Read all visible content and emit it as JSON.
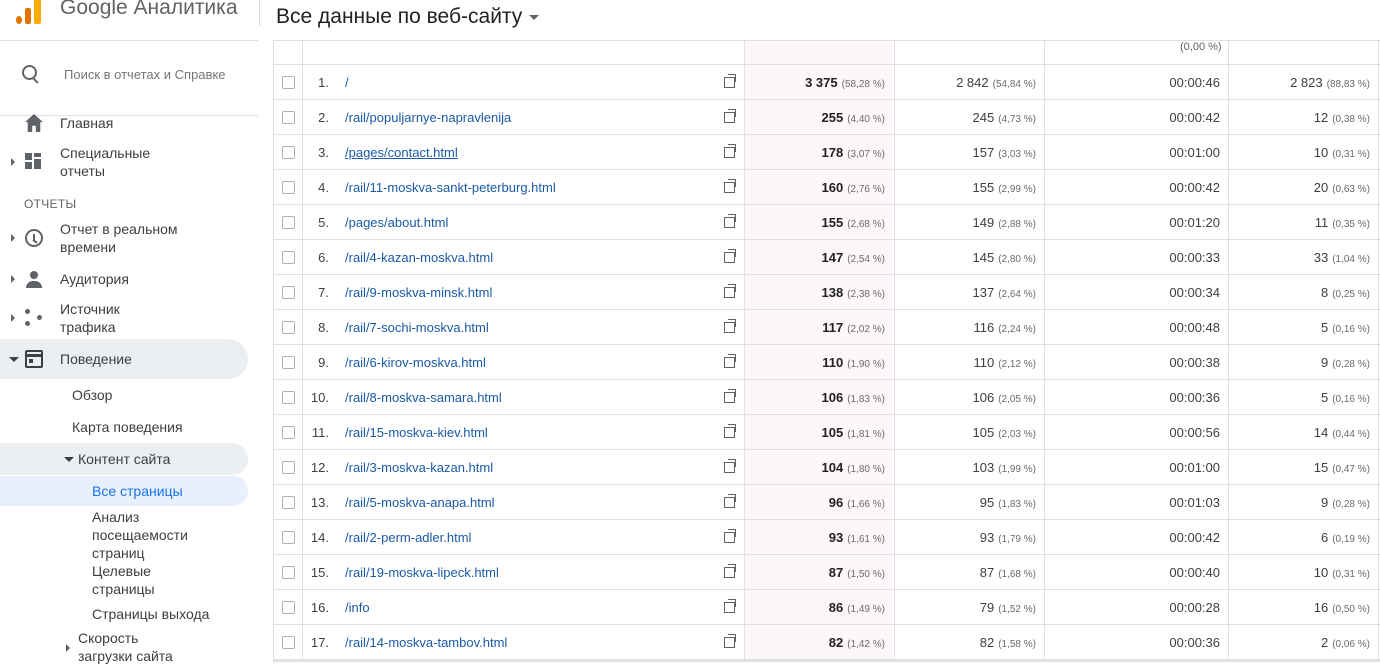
{
  "app": {
    "brand": "Google Аналитика",
    "view_title": "Все данные по веб-сайту"
  },
  "sidebar": {
    "search_placeholder": "Поиск в отчетах и Справке",
    "home": "Главная",
    "custom_line1": "Специальные",
    "custom_line2": "отчеты",
    "reports_section": "ОТЧЕТЫ",
    "realtime_line1": "Отчет в реальном",
    "realtime_line2": "времени",
    "audience": "Аудитория",
    "source_line1": "Источник",
    "source_line2": "трафика",
    "behavior": "Поведение",
    "overview": "Обзор",
    "behavior_map": "Карта поведения",
    "site_content": "Контент сайта",
    "all_pages": "Все страницы",
    "analysis_line1": "Анализ",
    "analysis_line2": "посещаемости",
    "analysis_line3": "страниц",
    "landing_line1": "Целевые",
    "landing_line2": "страницы",
    "exit_pages": "Страницы выхода",
    "speed_line1": "Скорость",
    "speed_line2": "загрузки сайта"
  },
  "table": {
    "header_pct": "(0,00 %)",
    "rows": [
      {
        "idx": "1.",
        "page": "/",
        "v1": "3 375",
        "p1": "(58,28 %)",
        "v2": "2 842",
        "p2": "(54,84 %)",
        "time": "00:00:46",
        "v4": "2 823",
        "p4": "(88,83 %)"
      },
      {
        "idx": "2.",
        "page": "/rail/populjarnye-napravlenija",
        "v1": "255",
        "p1": "(4,40 %)",
        "v2": "245",
        "p2": "(4,73 %)",
        "time": "00:00:42",
        "v4": "12",
        "p4": "(0,38 %)"
      },
      {
        "idx": "3.",
        "page": "/pages/contact.html",
        "v1": "178",
        "p1": "(3,07 %)",
        "v2": "157",
        "p2": "(3,03 %)",
        "time": "00:01:00",
        "v4": "10",
        "p4": "(0,31 %)"
      },
      {
        "idx": "4.",
        "page": "/rail/11-moskva-sankt-peterburg.html",
        "v1": "160",
        "p1": "(2,76 %)",
        "v2": "155",
        "p2": "(2,99 %)",
        "time": "00:00:42",
        "v4": "20",
        "p4": "(0,63 %)"
      },
      {
        "idx": "5.",
        "page": "/pages/about.html",
        "v1": "155",
        "p1": "(2,68 %)",
        "v2": "149",
        "p2": "(2,88 %)",
        "time": "00:01:20",
        "v4": "11",
        "p4": "(0,35 %)"
      },
      {
        "idx": "6.",
        "page": "/rail/4-kazan-moskva.html",
        "v1": "147",
        "p1": "(2,54 %)",
        "v2": "145",
        "p2": "(2,80 %)",
        "time": "00:00:33",
        "v4": "33",
        "p4": "(1,04 %)"
      },
      {
        "idx": "7.",
        "page": "/rail/9-moskva-minsk.html",
        "v1": "138",
        "p1": "(2,38 %)",
        "v2": "137",
        "p2": "(2,64 %)",
        "time": "00:00:34",
        "v4": "8",
        "p4": "(0,25 %)"
      },
      {
        "idx": "8.",
        "page": "/rail/7-sochi-moskva.html",
        "v1": "117",
        "p1": "(2,02 %)",
        "v2": "116",
        "p2": "(2,24 %)",
        "time": "00:00:48",
        "v4": "5",
        "p4": "(0,16 %)"
      },
      {
        "idx": "9.",
        "page": "/rail/6-kirov-moskva.html",
        "v1": "110",
        "p1": "(1,90 %)",
        "v2": "110",
        "p2": "(2,12 %)",
        "time": "00:00:38",
        "v4": "9",
        "p4": "(0,28 %)"
      },
      {
        "idx": "10.",
        "page": "/rail/8-moskva-samara.html",
        "v1": "106",
        "p1": "(1,83 %)",
        "v2": "106",
        "p2": "(2,05 %)",
        "time": "00:00:36",
        "v4": "5",
        "p4": "(0,16 %)"
      },
      {
        "idx": "11.",
        "page": "/rail/15-moskva-kiev.html",
        "v1": "105",
        "p1": "(1,81 %)",
        "v2": "105",
        "p2": "(2,03 %)",
        "time": "00:00:56",
        "v4": "14",
        "p4": "(0,44 %)"
      },
      {
        "idx": "12.",
        "page": "/rail/3-moskva-kazan.html",
        "v1": "104",
        "p1": "(1,80 %)",
        "v2": "103",
        "p2": "(1,99 %)",
        "time": "00:01:00",
        "v4": "15",
        "p4": "(0,47 %)"
      },
      {
        "idx": "13.",
        "page": "/rail/5-moskva-anapa.html",
        "v1": "96",
        "p1": "(1,66 %)",
        "v2": "95",
        "p2": "(1,83 %)",
        "time": "00:01:03",
        "v4": "9",
        "p4": "(0,28 %)"
      },
      {
        "idx": "14.",
        "page": "/rail/2-perm-adler.html",
        "v1": "93",
        "p1": "(1,61 %)",
        "v2": "93",
        "p2": "(1,79 %)",
        "time": "00:00:42",
        "v4": "6",
        "p4": "(0,19 %)"
      },
      {
        "idx": "15.",
        "page": "/rail/19-moskva-lipeck.html",
        "v1": "87",
        "p1": "(1,50 %)",
        "v2": "87",
        "p2": "(1,68 %)",
        "time": "00:00:40",
        "v4": "10",
        "p4": "(0,31 %)"
      },
      {
        "idx": "16.",
        "page": "/info",
        "v1": "86",
        "p1": "(1,49 %)",
        "v2": "79",
        "p2": "(1,52 %)",
        "time": "00:00:28",
        "v4": "16",
        "p4": "(0,50 %)"
      },
      {
        "idx": "17.",
        "page": "/rail/14-moskva-tambov.html",
        "v1": "82",
        "p1": "(1,42 %)",
        "v2": "82",
        "p2": "(1,58 %)",
        "time": "00:00:36",
        "v4": "2",
        "p4": "(0,06 %)"
      }
    ]
  }
}
